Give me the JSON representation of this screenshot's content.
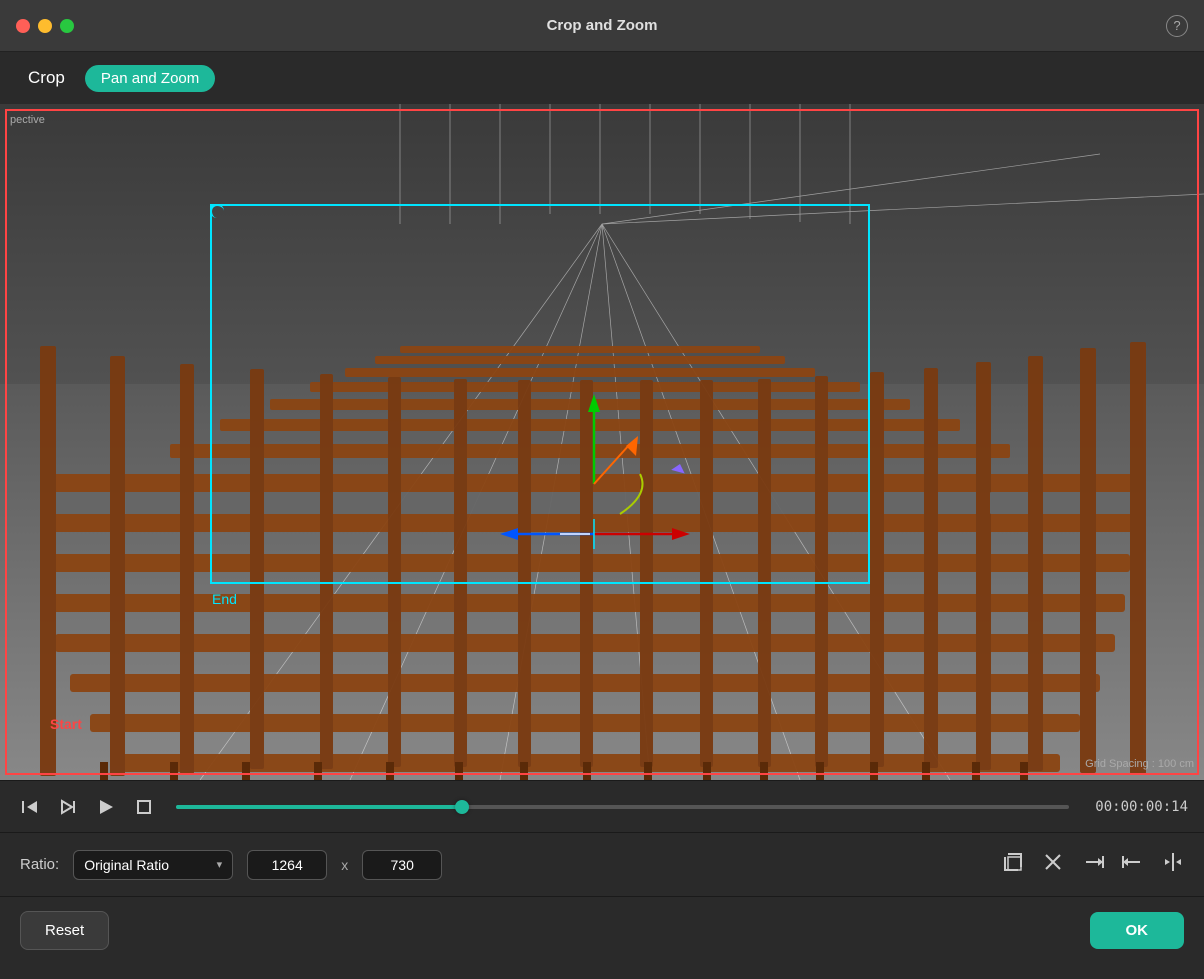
{
  "titlebar": {
    "title": "Crop and Zoom",
    "help_icon": "?"
  },
  "toolbar": {
    "crop_label": "Crop",
    "panzoom_label": "Pan and Zoom"
  },
  "viewport": {
    "perspective_label": "pective",
    "end_label": "End",
    "start_label": "Start",
    "grid_spacing_label": "Grid Spacing : 100 cm"
  },
  "transport": {
    "timecode": "00:00:00:14"
  },
  "ratio_bar": {
    "label": "Ratio:",
    "selected_ratio": "Original Ratio",
    "width": "1264",
    "height": "730",
    "x_separator": "x"
  },
  "bottom": {
    "reset_label": "Reset",
    "ok_label": "OK"
  }
}
